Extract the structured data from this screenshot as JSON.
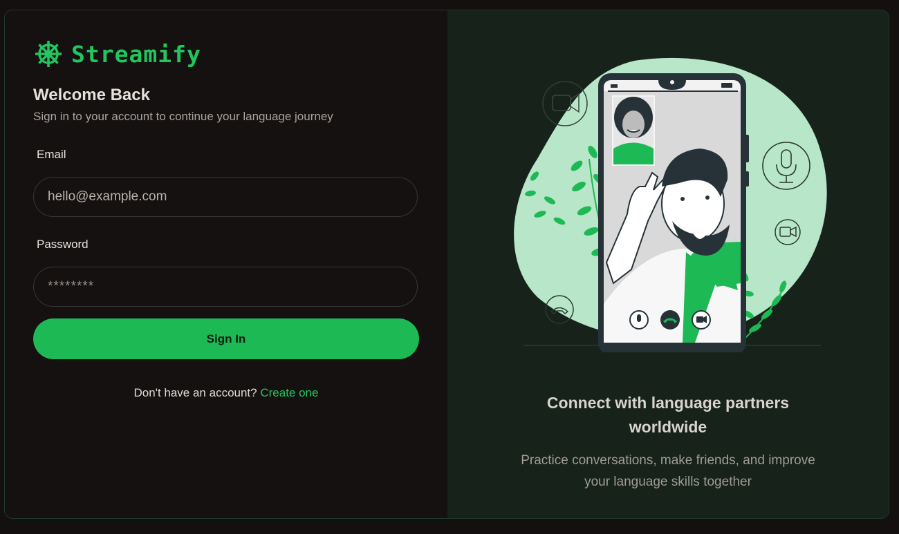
{
  "brand": {
    "name": "Streamify",
    "logo_icon": "ship-wheel-icon",
    "accent": "#22c55e"
  },
  "form": {
    "title": "Welcome Back",
    "subtitle": "Sign in to your account to continue your language journey",
    "email_label": "Email",
    "email_placeholder": "hello@example.com",
    "password_label": "Password",
    "password_placeholder": "********",
    "submit_label": "Sign In",
    "signup_prompt": "Don't have an account?",
    "signup_link": "Create one"
  },
  "hero": {
    "headline_line1": "Connect with language partners",
    "headline_line2": "worldwide",
    "description_line1": "Practice conversations, make friends, and improve",
    "description_line2": "your language skills together",
    "illustration": "video-call-illustration"
  },
  "colors": {
    "background": "#141010",
    "panel_left": "#151111",
    "panel_right": "#17221b",
    "button": "#1db954"
  }
}
